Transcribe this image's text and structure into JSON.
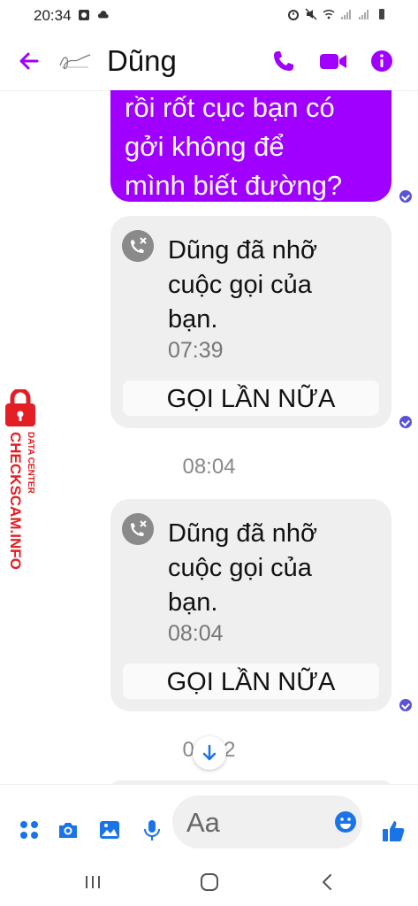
{
  "status_bar": {
    "time": "20:34"
  },
  "header": {
    "contact_name": "Dũng"
  },
  "messages": {
    "sent_text": "rồi rốt cục bạn có\ngởi không để\nmình biết đường?",
    "missed_calls": [
      {
        "text": "Dũng đã nhỡ\ncuộc gọi của\nbạn.",
        "time": "07:39",
        "action": "GỌI LẦN NỮA"
      },
      {
        "text": "Dũng đã nhỡ\ncuộc gọi của\nbạn.",
        "time": "08:04",
        "action": "GỌI LẦN NỮA"
      }
    ],
    "timestamps": [
      "08:04",
      "09:02"
    ]
  },
  "watermark": {
    "line1": "DATA CENTER",
    "line2": "CHECKSCAM.INFO"
  },
  "composer": {
    "placeholder": "Aa"
  },
  "colors": {
    "accent": "#9f00ff",
    "seen": "#5b53d8",
    "blue_icon": "#1a73e8",
    "watermark_red": "#e31e24"
  },
  "icons": [
    "back-arrow-icon",
    "phone-icon",
    "video-camera-icon",
    "info-icon",
    "missed-call-icon",
    "grid-menu-icon",
    "camera-icon",
    "image-icon",
    "microphone-icon",
    "emoji-icon",
    "thumbs-up-icon",
    "recent-apps-icon",
    "home-icon",
    "nav-back-icon",
    "lock-icon"
  ]
}
